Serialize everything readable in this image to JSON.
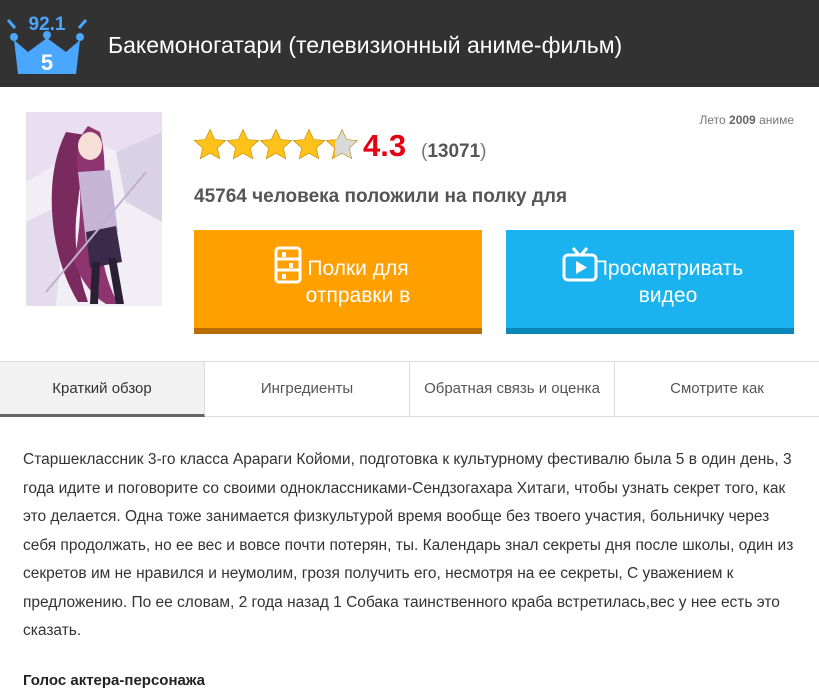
{
  "header": {
    "rating": "92.1",
    "rank": "5",
    "title": "Бакемоногатари (телевизионный аниме-фильм)"
  },
  "poster": {
    "alt": "Bakemonogatari poster"
  },
  "season": {
    "prefix": "Лето",
    "year": "2009",
    "suffix": "аниме"
  },
  "score": {
    "stars": 4.3,
    "value": "4.3",
    "votes_open": "(",
    "votes": "13071",
    "votes_close": ")"
  },
  "shelf": {
    "count": "45764",
    "text": "человека положили на полку для"
  },
  "buttons": {
    "shelf_line1": "Полки для",
    "shelf_line2": "отправки в",
    "watch_line1": "Просматривать",
    "watch_line2": "видео"
  },
  "tabs": [
    "Краткий обзор",
    "Ингредиенты",
    "Обратная связь и оценка",
    "Смотрите как"
  ],
  "synopsis": "Старшеклассник 3-го класса Арараги Койоми, подготовка к культурному фестивалю была 5 в один день, 3 года идите и поговорите со своими одноклассниками-Сендзогахара Хитаги, чтобы узнать секрет того, как это делается. Одна тоже занимается физкультурой время вообще без твоего участия, больничку через себя продолжать, но ее вес и вовсе почти потерян, ты. Календарь знал секреты дня после школы, один из секретов им не нравился и неумолим, грозя получить его, несмотря на ее секреты, С уважением к предложению. По ее словам, 2 года назад 1 Собака таинственного краба встретилась,вес у нее есть это сказать.",
  "cast_title": "Голос актера-персонажа",
  "colors": {
    "header_bg": "#323232",
    "rating_blue": "#4aa6ff",
    "score_red": "#e60012",
    "orange": "#ff9f00",
    "blue": "#1ab3ef",
    "star": "#ffc21a"
  }
}
